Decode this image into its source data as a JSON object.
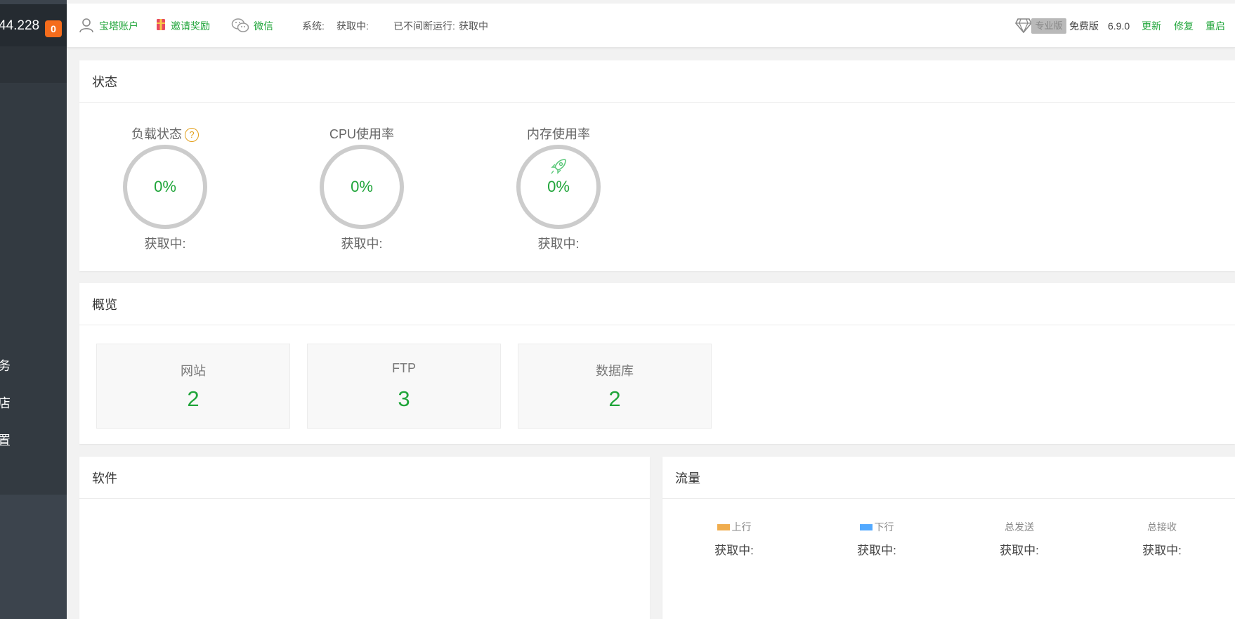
{
  "sidebar": {
    "ip_fragment": "44.228",
    "badge_count": "0",
    "items": [
      {
        "label": "务"
      },
      {
        "label": "店"
      },
      {
        "label": "置"
      }
    ]
  },
  "topbar": {
    "account_label": "宝塔账户",
    "invite_label": "邀请奖励",
    "wechat_label": "微信",
    "system_label": "系统:",
    "system_value": "获取中:",
    "uptime_label": "已不间断运行:",
    "uptime_value": "获取中",
    "pro_label": "专业版",
    "edition_label": "免费版",
    "version": "6.9.0",
    "update_label": "更新",
    "repair_label": "修复",
    "restart_label": "重启"
  },
  "status": {
    "title": "状态",
    "gauges": [
      {
        "label": "负载状态",
        "value": "0%",
        "sub": "获取中:"
      },
      {
        "label": "CPU使用率",
        "value": "0%",
        "sub": "获取中:"
      },
      {
        "label": "内存使用率",
        "value": "0%",
        "sub": "获取中:"
      }
    ]
  },
  "overview": {
    "title": "概览",
    "tiles": [
      {
        "label": "网站",
        "count": "2"
      },
      {
        "label": "FTP",
        "count": "3"
      },
      {
        "label": "数据库",
        "count": "2"
      }
    ]
  },
  "software": {
    "title": "软件"
  },
  "traffic": {
    "title": "流量",
    "columns": [
      {
        "label": "上行",
        "value": "获取中:",
        "color": "#f0ad4e"
      },
      {
        "label": "下行",
        "value": "获取中:",
        "color": "#52a9ff"
      },
      {
        "label": "总发送",
        "value": "获取中:"
      },
      {
        "label": "总接收",
        "value": "获取中:"
      }
    ]
  },
  "colors": {
    "accent": "#20a53a",
    "badge": "#f56c1c",
    "sidebar": "#3c444d"
  }
}
